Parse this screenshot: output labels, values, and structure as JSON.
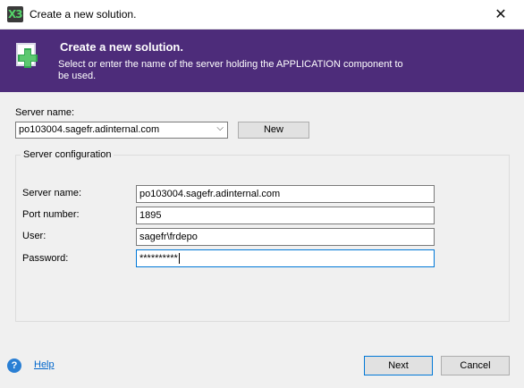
{
  "window": {
    "title": "Create a new solution.",
    "app_icon_text": "X3",
    "close_glyph": "✕"
  },
  "banner": {
    "title": "Create a new solution.",
    "description": "Select or enter the name of the server holding the APPLICATION component to be used."
  },
  "server_select": {
    "label": "Server name:",
    "value": "po103004.sagefr.adinternal.com",
    "dropdown_glyph": "⌵"
  },
  "new_button": {
    "label": "New"
  },
  "server_config": {
    "legend": "Server configuration",
    "server_name": {
      "label": "Server name:",
      "value": "po103004.sagefr.adinternal.com"
    },
    "port_number": {
      "label": "Port number:",
      "value": "1895"
    },
    "user": {
      "label": "User:",
      "value": "sagefr\\frdepo"
    },
    "password": {
      "label": "Password:",
      "value": "**********"
    }
  },
  "footer": {
    "help_icon_glyph": "?",
    "help_label": "Help",
    "next_label": "Next",
    "cancel_label": "Cancel"
  },
  "colors": {
    "banner": "#4d2c7a",
    "accent": "#0078d7",
    "link": "#0066cc"
  },
  "icons": {
    "banner_icon": "add-solution-icon",
    "help": "help-icon",
    "close": "close-icon"
  }
}
